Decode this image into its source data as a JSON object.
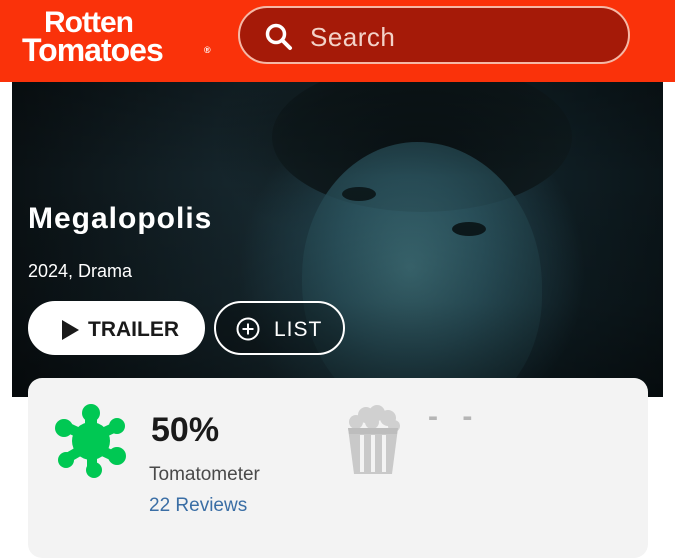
{
  "header": {
    "logo_line1": "Rotten",
    "logo_line2": "Tomatoes",
    "logo_reg": "®",
    "search_placeholder": "Search"
  },
  "hero": {
    "title": "Megalopolis",
    "meta": "2024, Drama",
    "trailer_label": "TRAILER",
    "list_label": "LIST"
  },
  "scores": {
    "tomatometer_value": "50%",
    "tomatometer_label": "Tomatometer",
    "reviews_link": "22 Reviews",
    "audience_value": "- -"
  },
  "colors": {
    "brand_red": "#fa320a",
    "splat_green": "#00c853",
    "link_blue": "#3a6ea5"
  },
  "icons": [
    "search-icon",
    "play-icon",
    "plus-circle-icon",
    "rotten-splat-icon",
    "popcorn-bucket-icon"
  ]
}
